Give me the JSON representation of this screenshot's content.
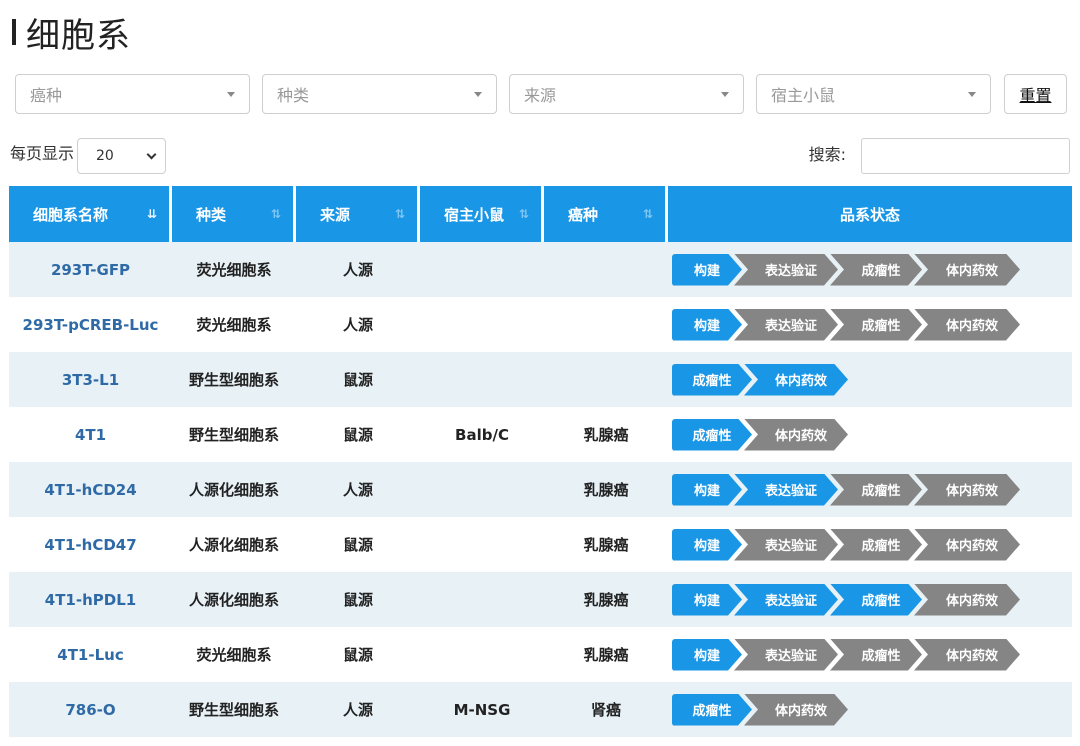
{
  "page": {
    "title": "细胞系"
  },
  "filters": [
    {
      "placeholder": "癌种"
    },
    {
      "placeholder": "种类"
    },
    {
      "placeholder": "来源"
    },
    {
      "placeholder": "宿主小鼠"
    }
  ],
  "reset_label": "重置",
  "pagesize": {
    "label": "每页显示",
    "value": "20"
  },
  "search": {
    "label": "搜索:",
    "value": ""
  },
  "table": {
    "headers": [
      "细胞系名称",
      "种类",
      "来源",
      "宿主小鼠",
      "癌种",
      "品系状态"
    ],
    "rows": [
      {
        "name": "293T-GFP",
        "type": "荧光细胞系",
        "source": "人源",
        "host": "",
        "cancer": "",
        "status": [
          [
            "构建",
            "blue"
          ],
          [
            "表达验证",
            "gray"
          ],
          [
            "成瘤性",
            "gray"
          ],
          [
            "体内药效",
            "gray"
          ]
        ]
      },
      {
        "name": "293T-pCREB-Luc",
        "type": "荧光细胞系",
        "source": "人源",
        "host": "",
        "cancer": "",
        "status": [
          [
            "构建",
            "blue"
          ],
          [
            "表达验证",
            "gray"
          ],
          [
            "成瘤性",
            "gray"
          ],
          [
            "体内药效",
            "gray"
          ]
        ]
      },
      {
        "name": "3T3-L1",
        "type": "野生型细胞系",
        "source": "鼠源",
        "host": "",
        "cancer": "",
        "status": [
          [
            "成瘤性",
            "blue"
          ],
          [
            "体内药效",
            "blue"
          ]
        ]
      },
      {
        "name": "4T1",
        "type": "野生型细胞系",
        "source": "鼠源",
        "host": "Balb/C",
        "cancer": "乳腺癌",
        "status": [
          [
            "成瘤性",
            "blue"
          ],
          [
            "体内药效",
            "gray"
          ]
        ]
      },
      {
        "name": "4T1-hCD24",
        "type": "人源化细胞系",
        "source": "人源",
        "host": "",
        "cancer": "乳腺癌",
        "status": [
          [
            "构建",
            "blue"
          ],
          [
            "表达验证",
            "blue"
          ],
          [
            "成瘤性",
            "gray"
          ],
          [
            "体内药效",
            "gray"
          ]
        ]
      },
      {
        "name": "4T1-hCD47",
        "type": "人源化细胞系",
        "source": "鼠源",
        "host": "",
        "cancer": "乳腺癌",
        "status": [
          [
            "构建",
            "blue"
          ],
          [
            "表达验证",
            "gray"
          ],
          [
            "成瘤性",
            "gray"
          ],
          [
            "体内药效",
            "gray"
          ]
        ]
      },
      {
        "name": "4T1-hPDL1",
        "type": "人源化细胞系",
        "source": "鼠源",
        "host": "",
        "cancer": "乳腺癌",
        "status": [
          [
            "构建",
            "blue"
          ],
          [
            "表达验证",
            "blue"
          ],
          [
            "成瘤性",
            "blue"
          ],
          [
            "体内药效",
            "gray"
          ]
        ]
      },
      {
        "name": "4T1-Luc",
        "type": "荧光细胞系",
        "source": "鼠源",
        "host": "",
        "cancer": "乳腺癌",
        "status": [
          [
            "构建",
            "blue"
          ],
          [
            "表达验证",
            "gray"
          ],
          [
            "成瘤性",
            "gray"
          ],
          [
            "体内药效",
            "gray"
          ]
        ]
      },
      {
        "name": "786-O",
        "type": "野生型细胞系",
        "source": "人源",
        "host": "M-NSG",
        "cancer": "肾癌",
        "status": [
          [
            "成瘤性",
            "blue"
          ],
          [
            "体内药效",
            "gray"
          ]
        ]
      }
    ]
  },
  "colors": {
    "accent": "#1a96e6",
    "inactive_step": "#858585",
    "row_alt": "#e7f1f6",
    "link": "#2f6aa6"
  },
  "icons": {
    "sort_active": "sort-desc-icon",
    "sort_inactive": "sort-both-icon",
    "dropdown": "caret-down-icon"
  }
}
